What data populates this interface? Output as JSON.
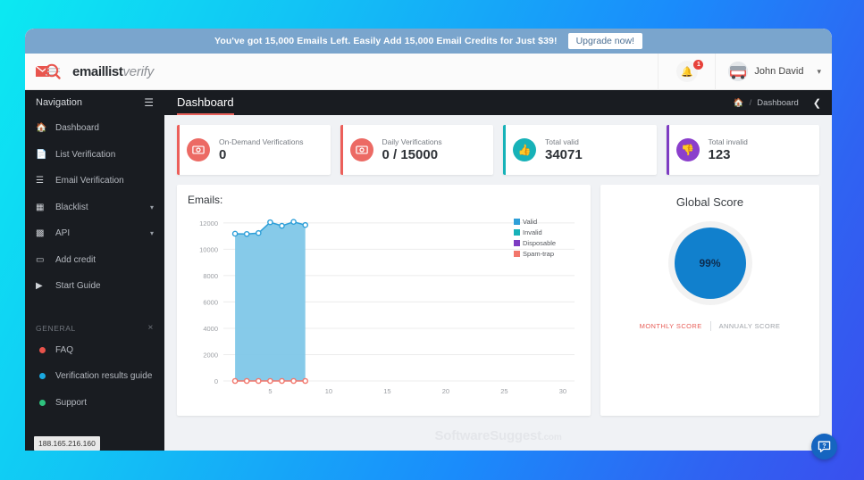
{
  "promo": {
    "text": "You've got 15,000 Emails Left. Easily Add 15,000 Email Credits for Just $39!",
    "button": "Upgrade now!"
  },
  "brand": {
    "bold": "emaillist",
    "italic": "verify"
  },
  "header": {
    "notification_count": "1",
    "user_name": "John David",
    "bell_icon": "bell-icon",
    "caret_icon": "chevron-down-icon"
  },
  "sidebar": {
    "heading": "Navigation",
    "burger_icon": "hamburger-icon",
    "items": [
      {
        "label": "Dashboard",
        "icon": "home-icon",
        "expandable": false
      },
      {
        "label": "List Verification",
        "icon": "file-icon",
        "expandable": false
      },
      {
        "label": "Email Verification",
        "icon": "list-icon",
        "expandable": false
      },
      {
        "label": "Blacklist",
        "icon": "window-icon",
        "expandable": true
      },
      {
        "label": "API",
        "icon": "code-file-icon",
        "expandable": true
      },
      {
        "label": "Add credit",
        "icon": "credit-card-icon",
        "expandable": false
      },
      {
        "label": "Start Guide",
        "icon": "video-icon",
        "expandable": false
      }
    ],
    "general": {
      "heading": "GENERAL",
      "close_icon": "close-icon",
      "items": [
        {
          "label": "FAQ",
          "color": "#e8534b"
        },
        {
          "label": "Verification results guide",
          "color": "#1aa8e0"
        },
        {
          "label": "Support",
          "color": "#2ec27e"
        }
      ]
    },
    "ip_tooltip": "188.165.216.160"
  },
  "page": {
    "title": "Dashboard",
    "breadcrumb_home_icon": "home-icon",
    "breadcrumb_separator": "/",
    "breadcrumb_current": "Dashboard",
    "collapse_icon": "chevron-left-icon"
  },
  "cards": [
    {
      "label": "On-Demand Verifications",
      "value": "0",
      "icon": "money-icon",
      "accent": "#ec5f5a"
    },
    {
      "label": "Daily Verifications",
      "value": "0 / 15000",
      "icon": "money-icon",
      "accent": "#ec5f5a"
    },
    {
      "label": "Total valid",
      "value": "34071",
      "icon": "thumbs-up-icon",
      "accent": "#17b2b8"
    },
    {
      "label": "Total invalid",
      "value": "123",
      "icon": "thumbs-down-icon",
      "accent": "#7d3cc2"
    }
  ],
  "score": {
    "title": "Global Score",
    "value": "99%",
    "tab_monthly": "MONTHLY SCORE",
    "tab_annual": "ANNUALY SCORE"
  },
  "watermark": {
    "main": "SoftwareSuggest",
    "suffix": ".com"
  },
  "help": {
    "icon": "help-chat-icon"
  },
  "chart_data": {
    "type": "area",
    "title": "Emails:",
    "xlabel": "",
    "ylabel": "",
    "xlim": [
      1,
      31
    ],
    "ylim": [
      0,
      12600
    ],
    "yticks": [
      0,
      2000,
      4000,
      6000,
      8000,
      10000,
      12000
    ],
    "ytick_labels": [
      "0",
      "2000",
      "4000",
      "6000",
      "8000",
      "10000",
      "12000"
    ],
    "xticks": [
      5,
      10,
      15,
      20,
      25,
      30
    ],
    "xtick_labels": [
      "5",
      "10",
      "15",
      "20",
      "25",
      "30"
    ],
    "grid": true,
    "legend_position": "right",
    "x": [
      2,
      3,
      4,
      5,
      6,
      7,
      8
    ],
    "series": [
      {
        "name": "Valid",
        "color": "#2e9fd8",
        "fill": "#7fc7e8",
        "values": [
          11180,
          11160,
          11230,
          12050,
          11780,
          12080,
          11840
        ]
      },
      {
        "name": "Invalid",
        "color": "#17b2b8",
        "fill": "#17b2b8",
        "values": [
          0,
          0,
          0,
          0,
          0,
          0,
          0
        ]
      },
      {
        "name": "Disposable",
        "color": "#7d3cc2",
        "fill": "#7d3cc2",
        "values": [
          0,
          0,
          0,
          0,
          0,
          0,
          0
        ]
      },
      {
        "name": "Spam-trap",
        "color": "#f2766b",
        "fill": "#f2766b",
        "values": [
          0,
          0,
          0,
          0,
          0,
          0,
          0
        ]
      }
    ]
  }
}
